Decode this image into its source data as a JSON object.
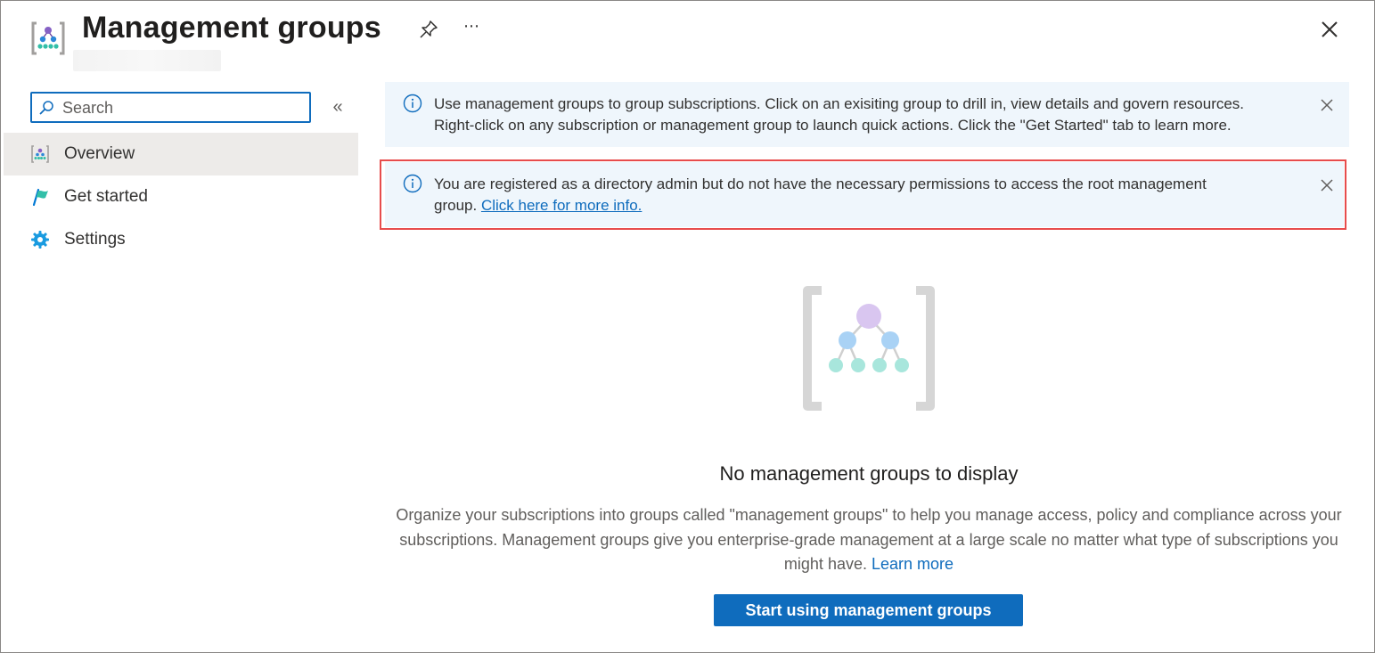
{
  "header": {
    "title": "Management groups",
    "more_label": "⋯"
  },
  "sidebar": {
    "search_placeholder": "Search",
    "collapse_label": "«",
    "items": [
      {
        "label": "Overview",
        "icon": "management-groups-icon",
        "active": true
      },
      {
        "label": "Get started",
        "icon": "flag-icon",
        "active": false
      },
      {
        "label": "Settings",
        "icon": "gear-icon",
        "active": false
      }
    ]
  },
  "banners": {
    "info": {
      "line1": "Use management groups to group subscriptions. Click on an exisiting group to drill in, view details and govern resources.",
      "line2": "Right-click on any subscription or management group to launch quick actions. Click the \"Get Started\" tab to learn more."
    },
    "warning": {
      "line1": "You are registered as a directory admin but do not have the necessary permissions to access the root management",
      "line2_prefix": "group.",
      "link": "Click here for more info."
    }
  },
  "empty_state": {
    "title": "No management groups to display",
    "description": "Organize your subscriptions into groups called \"management groups\" to help you manage access, policy and compliance across your subscriptions. Management groups give you enterprise-grade management at a large scale no matter what type of subscriptions you might have.",
    "learn_more": "Learn more",
    "button": "Start using management groups"
  },
  "colors": {
    "accent": "#0f6cbd",
    "banner_bg": "#eff6fc",
    "highlight_border": "#e74c4c",
    "active_nav_bg": "#edebe9"
  }
}
